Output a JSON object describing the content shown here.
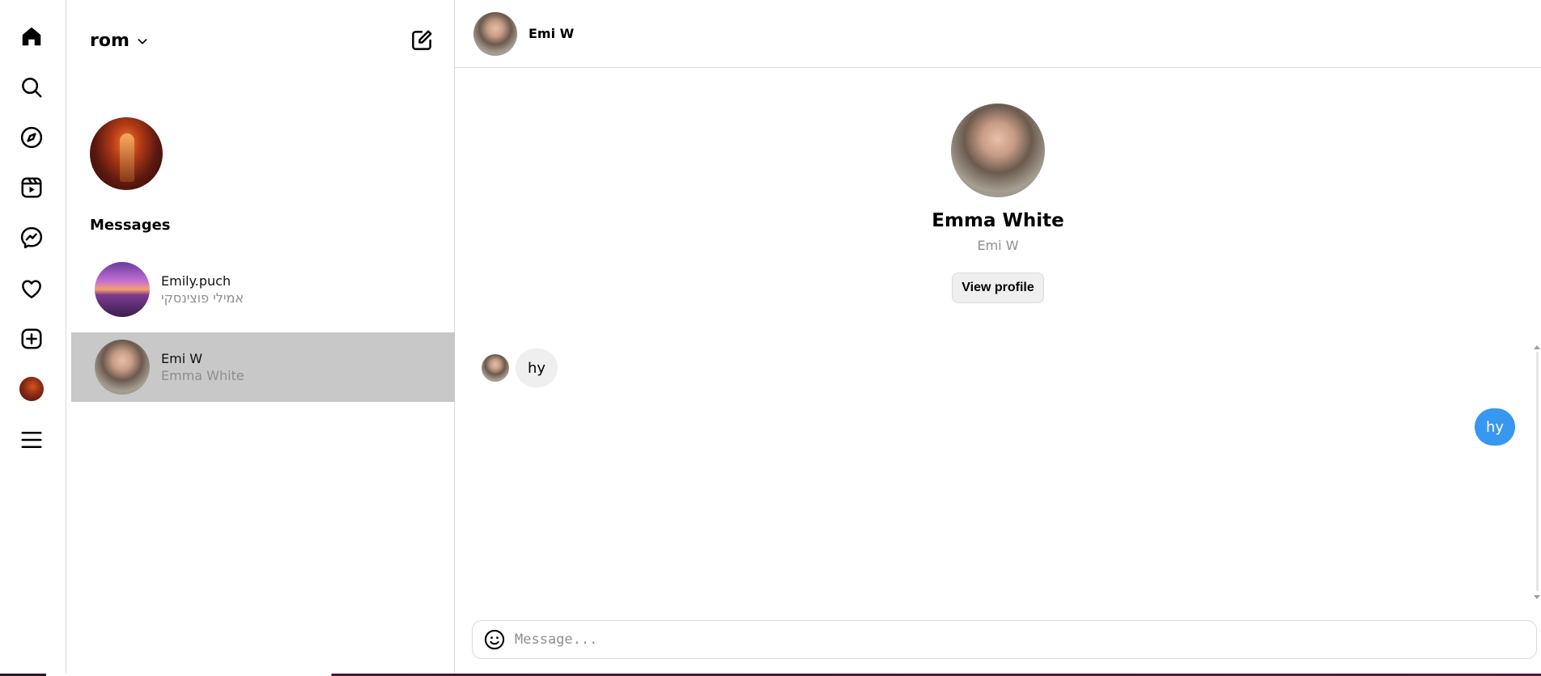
{
  "nav": {
    "items": [
      {
        "id": "home",
        "icon": "home-icon"
      },
      {
        "id": "search",
        "icon": "search-icon"
      },
      {
        "id": "explore",
        "icon": "compass-icon"
      },
      {
        "id": "reels",
        "icon": "reels-icon"
      },
      {
        "id": "messages",
        "icon": "messenger-icon"
      },
      {
        "id": "notifications",
        "icon": "heart-icon"
      },
      {
        "id": "create",
        "icon": "plus-square-icon"
      },
      {
        "id": "profile",
        "icon": "avatar"
      },
      {
        "id": "more",
        "icon": "menu-icon"
      }
    ]
  },
  "panel": {
    "account_name": "rom",
    "messages_title": "Messages",
    "conversations": [
      {
        "username": "Emily.puch",
        "fullname": "אמילי פוצינסקי",
        "active": false
      },
      {
        "username": "Emi W",
        "fullname": "Emma White",
        "active": true
      }
    ]
  },
  "chat": {
    "header_name": "Emi W",
    "profile_fullname": "Emma White",
    "profile_username": "Emi W",
    "view_profile_label": "View profile",
    "messages": [
      {
        "direction": "incoming",
        "text": "hy"
      },
      {
        "direction": "outgoing",
        "text": "hy"
      }
    ],
    "composer_placeholder": "Message...",
    "outgoing_color": "#3897f0",
    "incoming_color": "#efefef"
  }
}
